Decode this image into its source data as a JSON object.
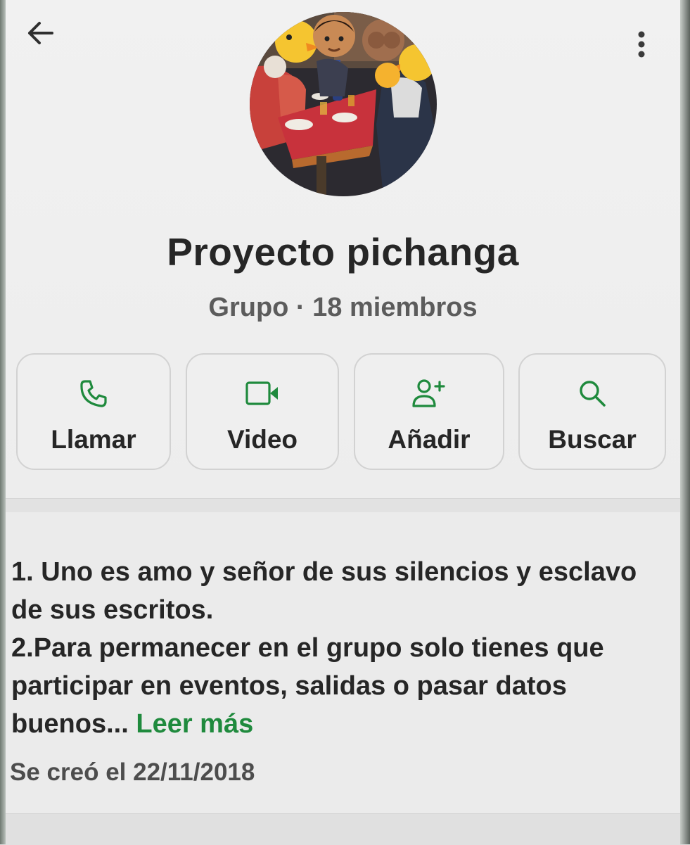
{
  "header": {
    "group_name": "Proyecto pichanga",
    "subtitle": "Grupo · 18 miembros",
    "back_icon": "arrow-left-icon",
    "menu_icon": "more-vertical-icon",
    "avatar": "group-photo"
  },
  "actions": [
    {
      "label": "Llamar",
      "icon": "phone-icon"
    },
    {
      "label": "Video",
      "icon": "video-camera-icon"
    },
    {
      "label": "Añadir",
      "icon": "add-person-icon"
    },
    {
      "label": "Buscar",
      "icon": "search-icon"
    }
  ],
  "description": {
    "line1": "1. Uno es amo y señor de sus silencios y esclavo de sus escritos.",
    "line2": "2.Para permanecer en el grupo solo tienes que participar en eventos, salidas o pasar datos buenos...",
    "read_more": "Leer más"
  },
  "created": "Se creó el 22/11/2018",
  "colors": {
    "accent": "#1f8a3d",
    "text": "#262626",
    "muted": "#5c5c5c",
    "background": "#efefef"
  }
}
